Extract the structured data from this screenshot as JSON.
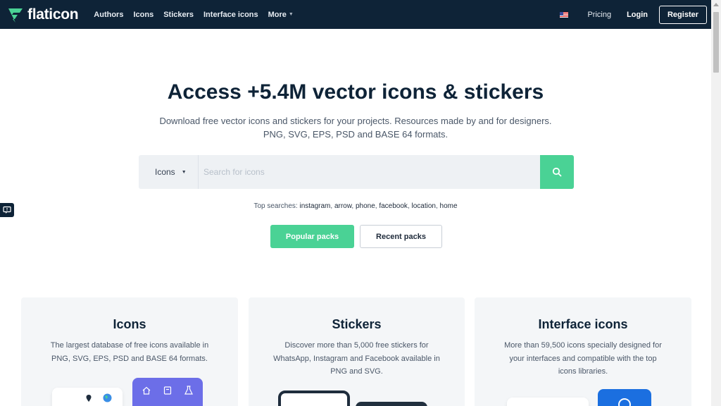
{
  "header": {
    "logo_text": "flaticon",
    "nav": [
      {
        "label": "Authors"
      },
      {
        "label": "Icons"
      },
      {
        "label": "Stickers"
      },
      {
        "label": "Interface icons"
      }
    ],
    "more_label": "More",
    "pricing_label": "Pricing",
    "login_label": "Login",
    "register_label": "Register"
  },
  "hero": {
    "title": "Access +5.4M vector icons & stickers",
    "subtitle_line1": "Download free vector icons and stickers for your projects. Resources made by and for designers.",
    "subtitle_line2": "PNG, SVG, EPS, PSD and BASE 64 formats."
  },
  "search": {
    "type_label": "Icons",
    "placeholder": "Search for icons"
  },
  "top_searches": {
    "label": "Top searches:",
    "items": [
      "instagram",
      "arrow",
      "phone",
      "facebook",
      "location",
      "home"
    ]
  },
  "buttons": {
    "popular": "Popular packs",
    "recent": "Recent packs"
  },
  "cards": [
    {
      "title": "Icons",
      "line1": "The largest database of free icons available in",
      "line2": "PNG, SVG, EPS, PSD and BASE 64 formats.",
      "line3": ""
    },
    {
      "title": "Stickers",
      "line1": "Discover more than 5,000 free stickers for",
      "line2": "WhatsApp, Instagram and Facebook available in",
      "line3": "PNG and SVG."
    },
    {
      "title": "Interface icons",
      "line1": "More than 59,500 icons specially designed for",
      "line2": "your interfaces and compatible with the top",
      "line3": "icons libraries."
    }
  ],
  "colors": {
    "header_bg": "#0e2337",
    "accent_green": "#4ad295",
    "card_bg": "#f4f6f8"
  }
}
